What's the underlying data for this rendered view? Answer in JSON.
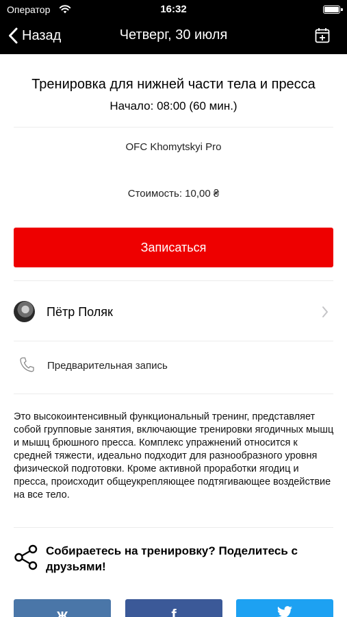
{
  "status_bar": {
    "carrier": "Оператор",
    "time": "16:32",
    "battery_level": 1.0
  },
  "nav": {
    "back_label": "Назад",
    "title": "Четверг, 30 июля",
    "calendar_icon": "calendar-add-icon"
  },
  "workout": {
    "title": "Тренировка для нижней части тела и пресса",
    "start": "Начало: 08:00 (60 мин.)",
    "club": "OFC Khomytskyi Pro",
    "price": "Стоимость: 10,00 ₴",
    "signup_label": "Записаться"
  },
  "trainer": {
    "name": "Пётр Поляк"
  },
  "booking": {
    "icon": "phone-icon",
    "label": "Предварительная запись"
  },
  "description": "Это высокоинтенсивный функциональный тренинг, представляет собой групповые занятия, включающие тренировки ягодичных мышц и мышц брюшного пресса. Комплекс упражнений относится к средней тяжести, идеально подходит для разнообразного уровня физической подготовки. Кроме активной проработки ягодиц и пресса, происходит общеукрепляющее подтягивающее воздействие на все тело.",
  "share": {
    "text": "Собираетесь на тренировку? Поделитесь с друзьями!",
    "buttons": [
      {
        "name": "vk",
        "glyph": "ж",
        "color": "#4a76a8"
      },
      {
        "name": "facebook",
        "glyph": "f",
        "color": "#3b5998"
      },
      {
        "name": "twitter",
        "glyph": "🐦",
        "color": "#1da1f2"
      }
    ]
  },
  "colors": {
    "accent": "#ee0000",
    "header_bg": "#000000"
  }
}
